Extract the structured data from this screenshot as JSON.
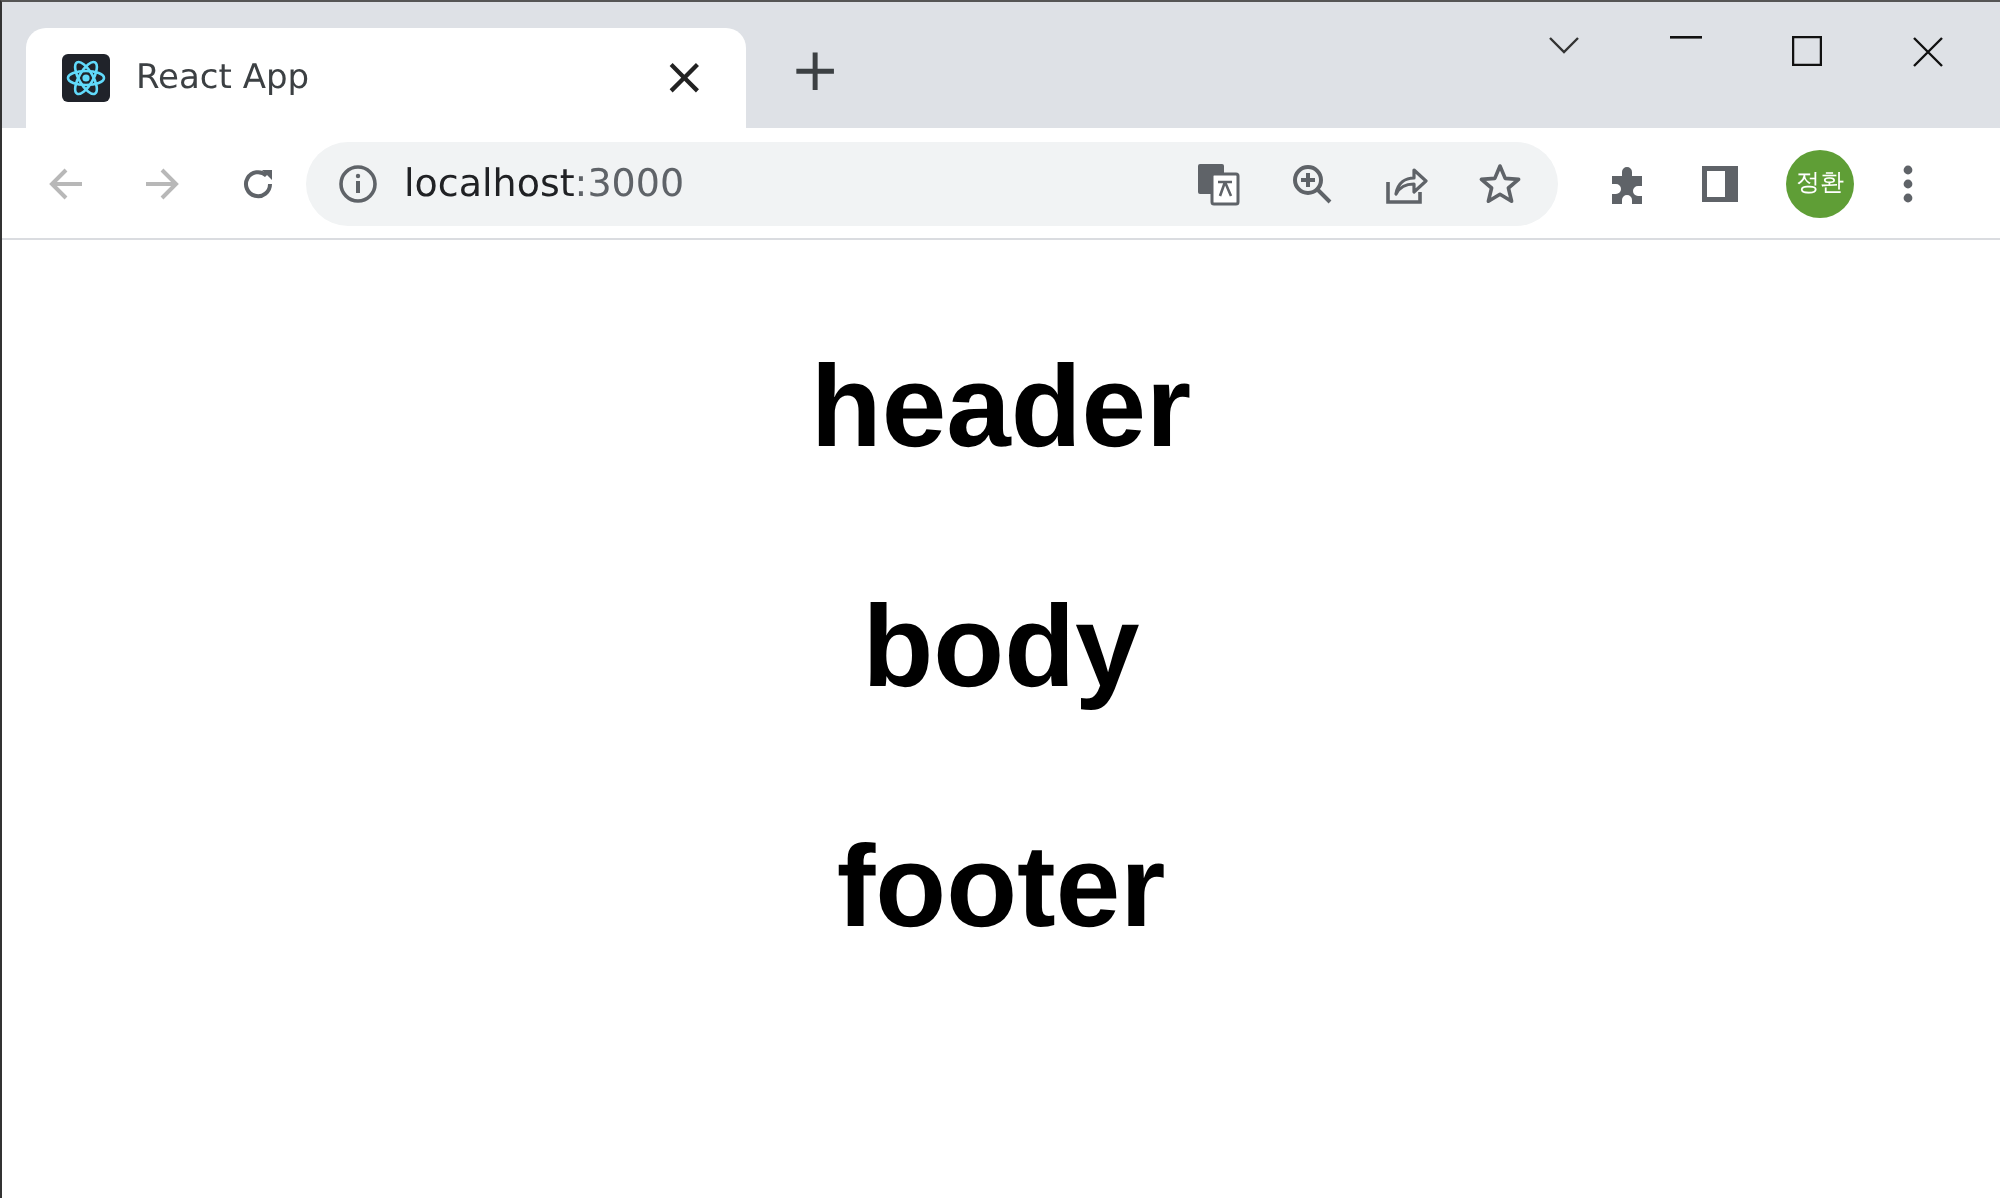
{
  "tabs": [
    {
      "title": "React App",
      "close": "×",
      "selected": true
    }
  ],
  "new_tab": "+",
  "address_bar": {
    "host": "localhost",
    "port": ":3000"
  },
  "profile": {
    "initials": "정환",
    "color": "#5f9e36"
  },
  "nav": {
    "back_disabled": true,
    "forward_disabled": true
  },
  "page": {
    "headings": [
      "header",
      "body",
      "footer"
    ]
  }
}
